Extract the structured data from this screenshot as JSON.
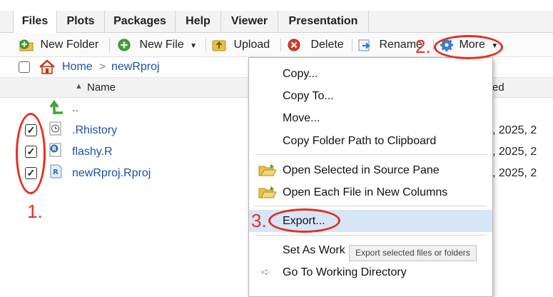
{
  "tabs": [
    "Files",
    "Plots",
    "Packages",
    "Help",
    "Viewer",
    "Presentation"
  ],
  "toolbar": {
    "new_folder": "New Folder",
    "new_file": "New File",
    "upload": "Upload",
    "delete": "Delete",
    "rename": "Rename",
    "more": "More"
  },
  "breadcrumb": {
    "home": "Home",
    "sep": ">",
    "current": "newRproj"
  },
  "header": {
    "name": "Name",
    "modified_partial": "ed"
  },
  "files": [
    {
      "name": "..",
      "checked": false,
      "date": ""
    },
    {
      "name": ".Rhistory",
      "checked": true,
      "date": ", 2025, 2"
    },
    {
      "name": "flashy.R",
      "checked": true,
      "date": ", 2025, 2"
    },
    {
      "name": "newRproj.Rproj",
      "checked": true,
      "date": ", 2025, 2"
    }
  ],
  "menu": {
    "copy": "Copy...",
    "copy_to": "Copy To...",
    "move": "Move...",
    "copy_path": "Copy Folder Path to Clipboard",
    "open_source": "Open Selected in Source Pane",
    "open_columns": "Open Each File in New Columns",
    "export": "Export...",
    "set_wd": "Set As Work",
    "goto_wd": "Go To Working Directory"
  },
  "tooltip": "Export selected files or folders",
  "annotations": [
    "1.",
    "2.",
    "3."
  ],
  "colors": {
    "annotation": "#e43022",
    "link": "#1d4fa8",
    "highlight": "#d7e6f7"
  }
}
